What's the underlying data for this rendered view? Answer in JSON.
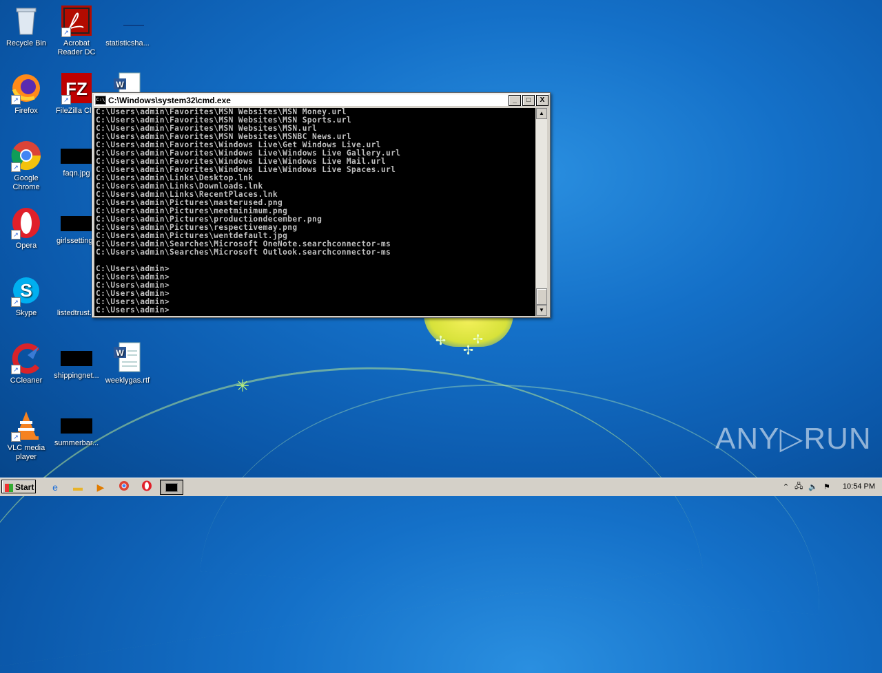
{
  "desktop": {
    "icons": [
      {
        "id": "recycle-bin",
        "label": "Recycle Bin"
      },
      {
        "id": "acrobat",
        "label": "Acrobat Reader DC"
      },
      {
        "id": "statistics",
        "label": "statisticsha..."
      },
      {
        "id": "firefox",
        "label": "Firefox"
      },
      {
        "id": "filezilla",
        "label": "FileZilla Clie"
      },
      {
        "id": "chrome",
        "label": "Google Chrome"
      },
      {
        "id": "faqn",
        "label": "faqn.jpg"
      },
      {
        "id": "opera",
        "label": "Opera"
      },
      {
        "id": "girlssettings",
        "label": "girlssettings"
      },
      {
        "id": "skype",
        "label": "Skype"
      },
      {
        "id": "listedtrust",
        "label": "listedtrust.p"
      },
      {
        "id": "ccleaner",
        "label": "CCleaner"
      },
      {
        "id": "shippingnet",
        "label": "shippingnet..."
      },
      {
        "id": "weeklygas",
        "label": "weeklygas.rtf"
      },
      {
        "id": "vlc",
        "label": "VLC media player"
      },
      {
        "id": "summerbar",
        "label": "summerbar..."
      }
    ]
  },
  "cmd_window": {
    "title": "C:\\Windows\\system32\\cmd.exe",
    "lines": [
      "C:\\Users\\admin\\Favorites\\MSN Websites\\MSN Money.url",
      "C:\\Users\\admin\\Favorites\\MSN Websites\\MSN Sports.url",
      "C:\\Users\\admin\\Favorites\\MSN Websites\\MSN.url",
      "C:\\Users\\admin\\Favorites\\MSN Websites\\MSNBC News.url",
      "C:\\Users\\admin\\Favorites\\Windows Live\\Get Windows Live.url",
      "C:\\Users\\admin\\Favorites\\Windows Live\\Windows Live Gallery.url",
      "C:\\Users\\admin\\Favorites\\Windows Live\\Windows Live Mail.url",
      "C:\\Users\\admin\\Favorites\\Windows Live\\Windows Live Spaces.url",
      "C:\\Users\\admin\\Links\\Desktop.lnk",
      "C:\\Users\\admin\\Links\\Downloads.lnk",
      "C:\\Users\\admin\\Links\\RecentPlaces.lnk",
      "C:\\Users\\admin\\Pictures\\masterused.png",
      "C:\\Users\\admin\\Pictures\\meetminimum.png",
      "C:\\Users\\admin\\Pictures\\productiondecember.png",
      "C:\\Users\\admin\\Pictures\\respectivemay.png",
      "C:\\Users\\admin\\Pictures\\wentdefault.jpg",
      "C:\\Users\\admin\\Searches\\Microsoft OneNote.searchconnector-ms",
      "C:\\Users\\admin\\Searches\\Microsoft Outlook.searchconnector-ms",
      "",
      "C:\\Users\\admin>",
      "C:\\Users\\admin>",
      "C:\\Users\\admin>",
      "C:\\Users\\admin>",
      "C:\\Users\\admin>",
      "C:\\Users\\admin>"
    ],
    "buttons": {
      "minimize": "_",
      "maximize": "□",
      "close": "X"
    }
  },
  "watermark": "ANY▷RUN",
  "taskbar": {
    "start_label": "Start",
    "clock": "10:54 PM",
    "colors": {
      "bar": "#d4d0c8"
    }
  }
}
